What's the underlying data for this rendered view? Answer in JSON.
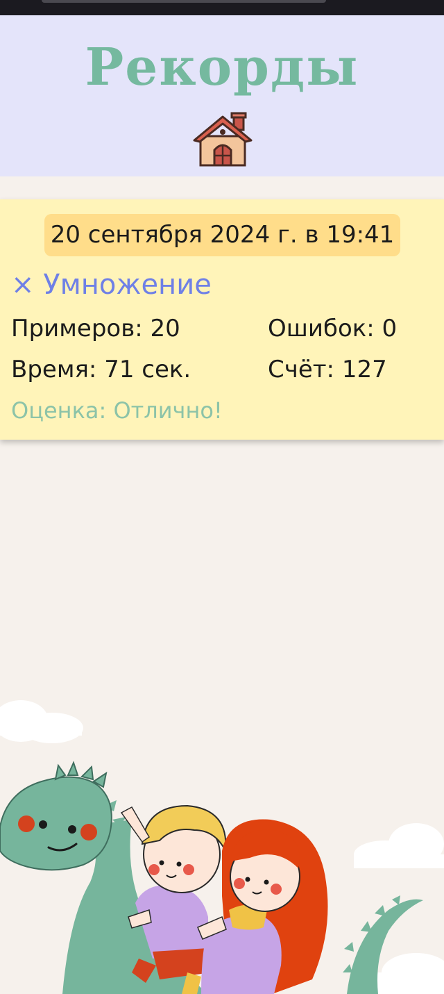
{
  "header": {
    "title": "Рекорды",
    "home_icon": "house-icon"
  },
  "record": {
    "date": "20 сентября 2024 г. в 19:41",
    "operation": "× Умножение",
    "examples": "Примеров: 20",
    "errors": "Ошибок: 0",
    "time": "Время: 71 сек.",
    "score": "Счёт: 127",
    "grade": "Оценка: Отлично!"
  },
  "illustration": {
    "icon": "dragon-kids-illustration"
  },
  "colors": {
    "header_bg": "#e4e4fa",
    "title": "#75b99f",
    "card_bg": "#fff4b9",
    "date_pill": "#ffdd8a",
    "operation": "#6f80e6",
    "grade": "#8cc3a8",
    "page_bg": "#f6f1ec"
  }
}
